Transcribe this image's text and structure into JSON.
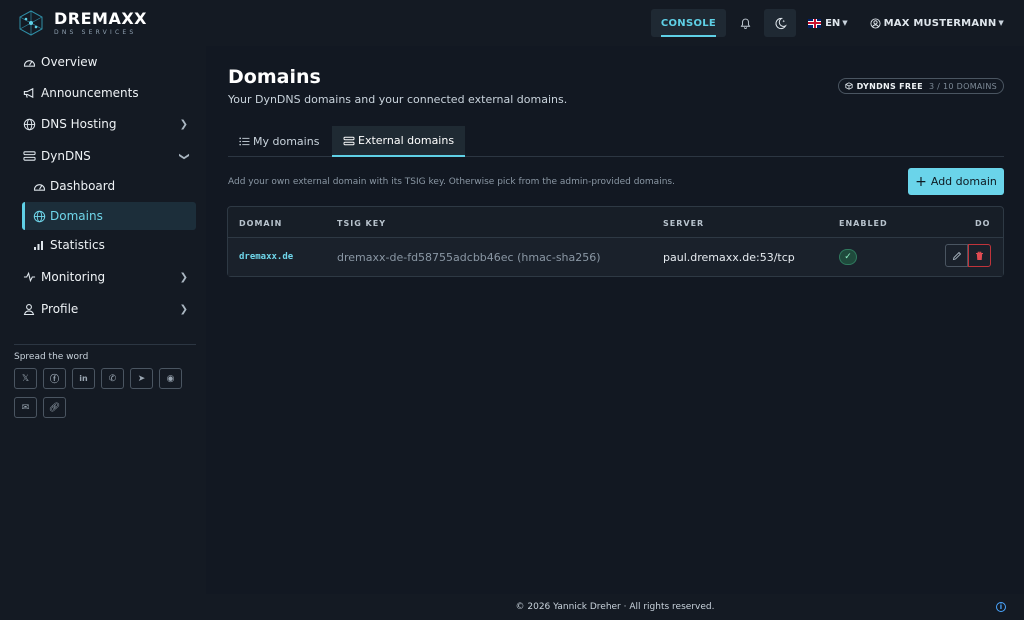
{
  "brand": {
    "name": "DREMAXX",
    "subtitle": "DNS SERVICES"
  },
  "topbar": {
    "console_label": "CONSOLE",
    "language": "EN",
    "user_name": "MAX MUSTERMANN"
  },
  "sidebar": {
    "items": [
      {
        "label": "Overview",
        "icon": "dashboard-gauge-icon"
      },
      {
        "label": "Announcements",
        "icon": "megaphone-icon"
      },
      {
        "label": "DNS Hosting",
        "icon": "globe-icon"
      },
      {
        "label": "DynDNS",
        "icon": "sliders-icon"
      },
      {
        "label": "Monitoring",
        "icon": "activity-icon"
      },
      {
        "label": "Profile",
        "icon": "person-icon"
      }
    ],
    "dyndns_sub": [
      {
        "label": "Dashboard",
        "icon": "gauge-icon"
      },
      {
        "label": "Domains",
        "icon": "globe-icon"
      },
      {
        "label": "Statistics",
        "icon": "bar-chart-icon"
      }
    ],
    "spread_label": "Spread the word",
    "share_icons": [
      "x-icon",
      "facebook-icon",
      "linkedin-icon",
      "whatsapp-icon",
      "telegram-icon",
      "reddit-icon",
      "mail-icon",
      "link-icon"
    ]
  },
  "page": {
    "title": "Domains",
    "subtitle": "Your DynDNS domains and your connected external domains.",
    "plan_name": "DYNDNS FREE",
    "plan_usage": "3 / 10 DOMAINS",
    "tabs": [
      {
        "label": "My domains"
      },
      {
        "label": "External domains"
      }
    ],
    "hint": "Add your own external domain with its TSIG key. Otherwise pick from the admin-provided domains.",
    "add_button": "Add domain"
  },
  "table": {
    "headers": [
      "DOMAIN",
      "TSIG KEY",
      "SERVER",
      "ENABLED",
      "DO"
    ],
    "rows": [
      {
        "domain": "dremaxx.de",
        "tsig": "dremaxx-de-fd58755adcbb46ec (hmac-sha256)",
        "server": "paul.dremaxx.de:53/tcp",
        "enabled": true
      }
    ]
  },
  "footer": {
    "text": "© 2026 Yannick Dreher · All rights reserved."
  },
  "colors": {
    "accent": "#6ad4ea",
    "danger": "#e04b52",
    "success": "#2f7a5e"
  }
}
